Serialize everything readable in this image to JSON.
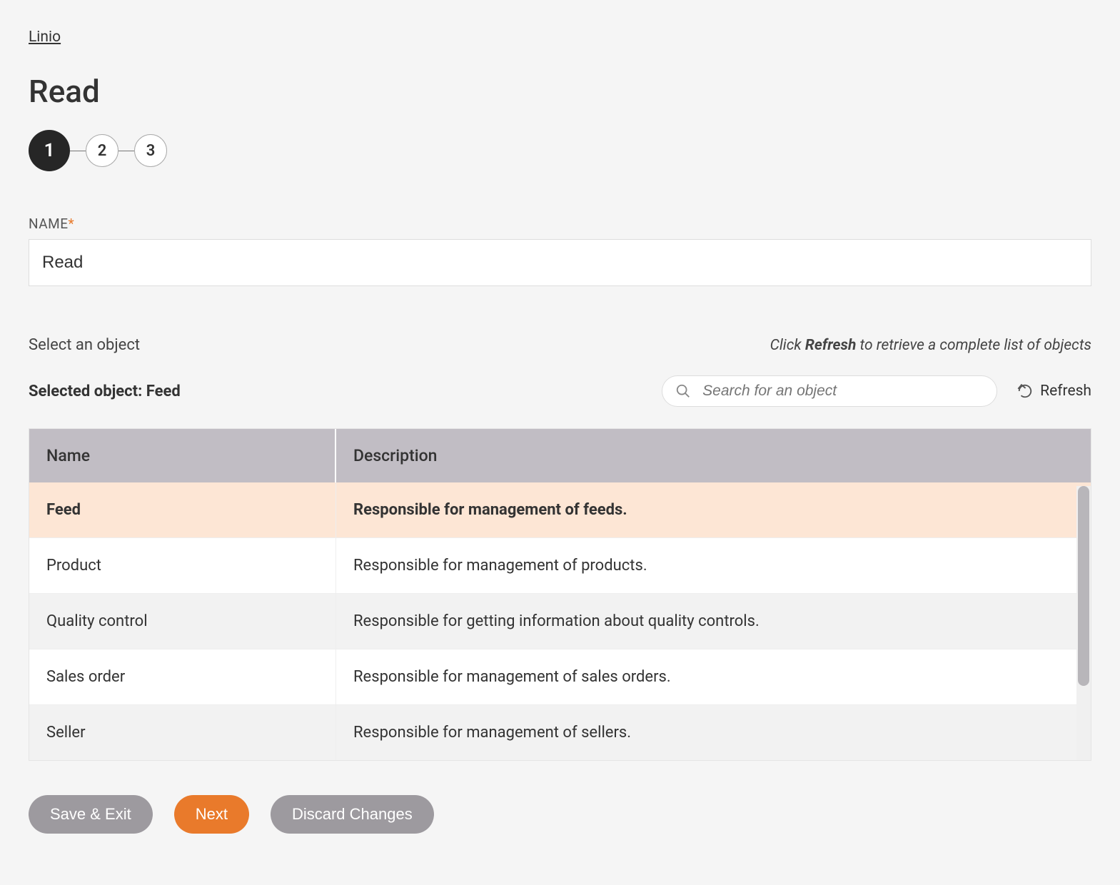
{
  "breadcrumb": {
    "label": "Linio"
  },
  "title": "Read",
  "stepper": {
    "steps": [
      "1",
      "2",
      "3"
    ],
    "active_index": 0
  },
  "form": {
    "name_label": "NAME",
    "name_required_mark": "*",
    "name_value": "Read"
  },
  "object_section": {
    "select_label": "Select an object",
    "hint_prefix": "Click ",
    "hint_bold": "Refresh",
    "hint_suffix": " to retrieve a complete list of objects",
    "selected_prefix": "Selected object: ",
    "selected_value": "Feed",
    "search_placeholder": "Search for an object",
    "refresh_label": "Refresh"
  },
  "table": {
    "columns": {
      "name": "Name",
      "description": "Description"
    },
    "rows": [
      {
        "name": "Feed",
        "description": "Responsible for management of feeds.",
        "selected": true
      },
      {
        "name": "Product",
        "description": "Responsible for management of products."
      },
      {
        "name": "Quality control",
        "description": "Responsible for getting information about quality controls."
      },
      {
        "name": "Sales order",
        "description": "Responsible for management of sales orders."
      },
      {
        "name": "Seller",
        "description": "Responsible for management of sellers."
      }
    ]
  },
  "footer": {
    "save_exit": "Save & Exit",
    "next": "Next",
    "discard": "Discard Changes"
  }
}
